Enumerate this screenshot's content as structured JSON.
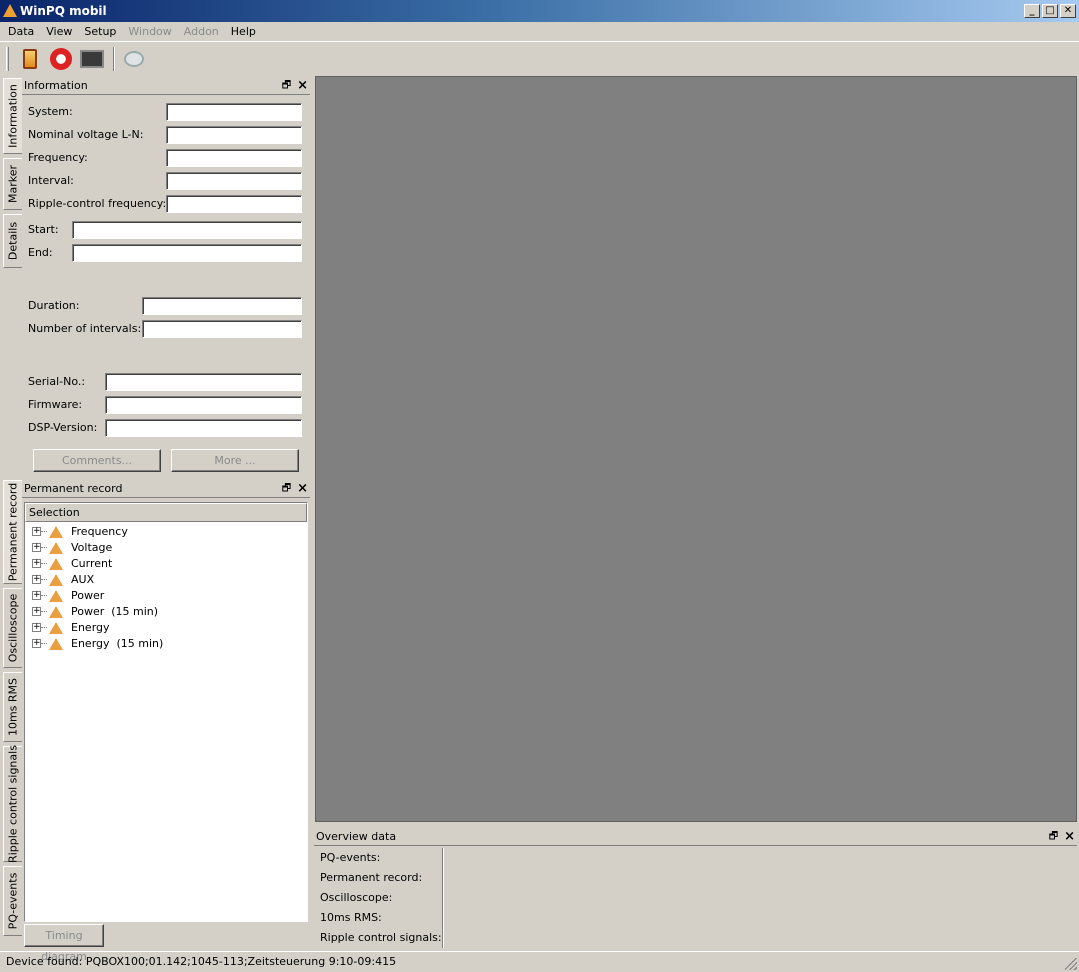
{
  "window": {
    "title": "WinPQ mobil",
    "minimize": "_",
    "maximize": "□",
    "close": "✕"
  },
  "menu": {
    "items": [
      "Data",
      "View",
      "Setup",
      "Window",
      "Addon",
      "Help"
    ]
  },
  "left_tabs_top": [
    "Information",
    "Marker",
    "Details"
  ],
  "left_tabs_bottom": [
    "Permanent record",
    "Oscilloscope",
    "10ms RMS",
    "Ripple control signals",
    "PQ-events"
  ],
  "information": {
    "title": "Information",
    "fields": [
      {
        "label": "System:",
        "value": ""
      },
      {
        "label": "Nominal voltage L-N:",
        "value": ""
      },
      {
        "label": "Frequency:",
        "value": ""
      },
      {
        "label": "Interval:",
        "value": ""
      },
      {
        "label": "Ripple-control frequency:",
        "value": ""
      },
      {
        "label": "Start:",
        "value": ""
      },
      {
        "label": "End:",
        "value": ""
      },
      {
        "label": "Duration:",
        "value": ""
      },
      {
        "label": "Number of intervals:",
        "value": ""
      },
      {
        "label": "Serial-No.:",
        "value": ""
      },
      {
        "label": "Firmware:",
        "value": ""
      },
      {
        "label": "DSP-Version:",
        "value": ""
      }
    ],
    "comments_button": "Comments...",
    "more_button": "More ..."
  },
  "permanent_record": {
    "title": "Permanent record",
    "column": "Selection",
    "items": [
      "Frequency",
      "Voltage",
      "Current",
      "AUX",
      "Power",
      "Power  (15 min)",
      "Energy",
      "Energy  (15 min)"
    ],
    "timing_button": "Timing diagram"
  },
  "overview": {
    "title": "Overview data",
    "labels": [
      "PQ-events:",
      "Permanent record:",
      "Oscilloscope:",
      "10ms RMS:",
      "Ripple control signals:"
    ]
  },
  "status": "Device found: PQBOX100;01.142;1045-113;Zeitsteuerung 9:10-09:415"
}
